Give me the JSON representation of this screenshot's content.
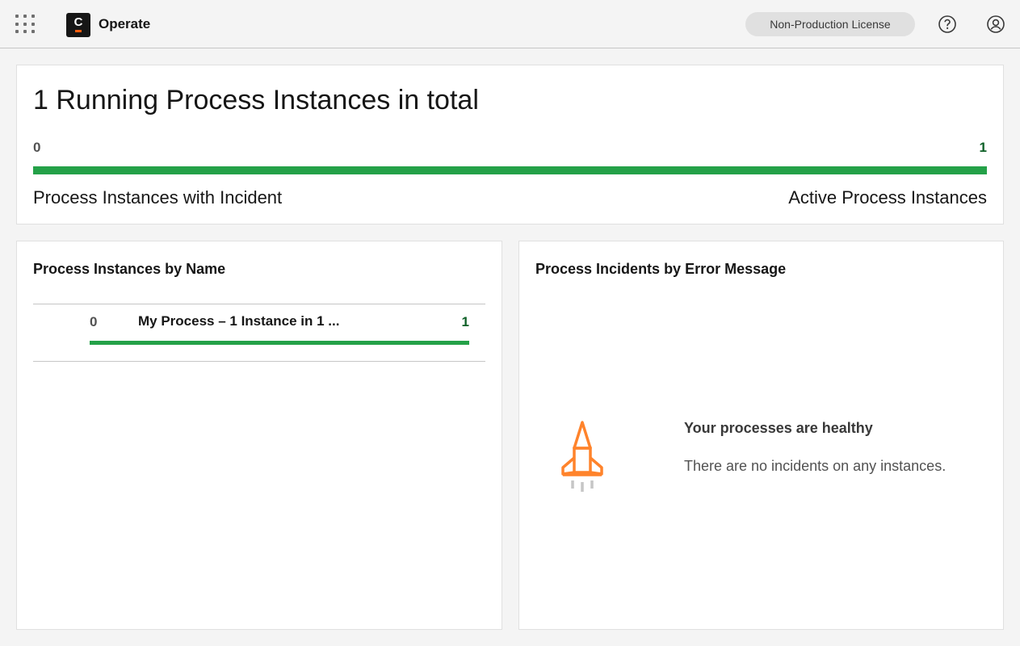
{
  "header": {
    "app_name": "Operate",
    "logo_letter": "C",
    "license_badge": "Non-Production License",
    "icons": [
      "app-switcher-icon",
      "help-icon",
      "user-icon"
    ]
  },
  "total_card": {
    "title": "1 Running Process Instances in total",
    "incident_count": "0",
    "active_count": "1",
    "active_fraction": 1.0,
    "incident_label": "Process Instances with Incident",
    "active_label": "Active Process Instances",
    "colors": {
      "active": "#24a148",
      "incident": "#da1e28"
    }
  },
  "name_card": {
    "title": "Process Instances by Name",
    "rows": [
      {
        "incident_count": "0",
        "name": "My Process – 1 Instance in 1 ...",
        "active_count": "1",
        "active_fraction": 1.0
      }
    ]
  },
  "error_card": {
    "title": "Process Incidents by Error Message",
    "empty_title": "Your processes are healthy",
    "empty_desc": "There are no incidents on any instances.",
    "empty_icon": "rocket-icon",
    "icon_color": "#ff832b"
  }
}
